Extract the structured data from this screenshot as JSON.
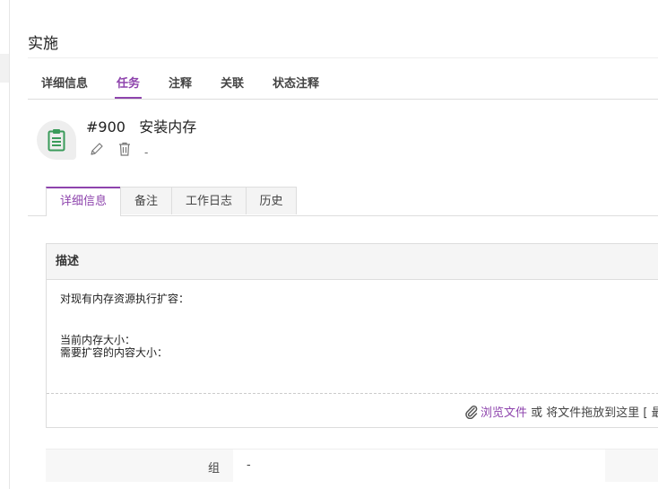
{
  "page": {
    "title": "实施"
  },
  "main_tabs": [
    {
      "label": "详细信息",
      "active": false
    },
    {
      "label": "任务",
      "active": true
    },
    {
      "label": "注释",
      "active": false
    },
    {
      "label": "关联",
      "active": false
    },
    {
      "label": "状态注释",
      "active": false
    }
  ],
  "task": {
    "title": "#900   安装内存",
    "assignee": "-",
    "icon": "clipboard-icon",
    "icon_color": "#3a9b5a"
  },
  "sub_tabs": [
    {
      "label": "详细信息",
      "active": true
    },
    {
      "label": "备注",
      "active": false
    },
    {
      "label": "工作日志",
      "active": false
    },
    {
      "label": "历史",
      "active": false
    }
  ],
  "description": {
    "header": "描述",
    "lines": [
      "对现有内存资源执行扩容：",
      "当前内存大小：",
      "需要扩容的内容大小："
    ]
  },
  "attachments": {
    "browse_link": "浏览文件",
    "drop_text": " 或 将文件拖放到这里 [ 最"
  },
  "group": {
    "label": "组",
    "value": "-"
  },
  "colors": {
    "accent": "#8e44ad"
  }
}
